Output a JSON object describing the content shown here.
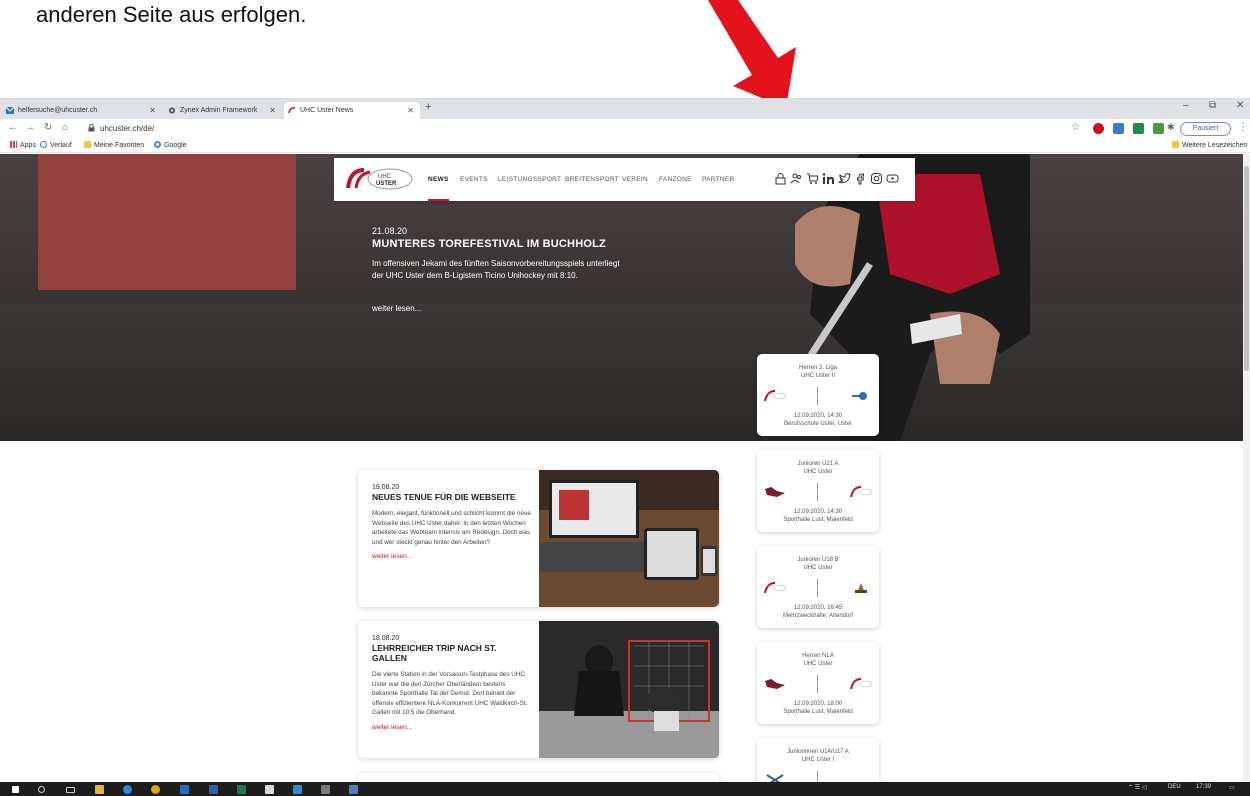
{
  "document": {
    "text": "anderen Seite aus erfolgen."
  },
  "browser": {
    "tabs": [
      {
        "label": "helfersuche@uhcuster.ch"
      },
      {
        "label": "Zynex Admin Framework"
      },
      {
        "label": "UHC Uster News"
      }
    ],
    "url": "uhcuster.ch/de/",
    "pause_label": "Pausiert",
    "bookmarks": [
      "Apps",
      "Verlauf",
      "Meine Favoriten",
      "Google"
    ],
    "bookmarks_right": "Weitere Lesezeichen"
  },
  "site": {
    "logo_alt": "UHC USTER",
    "nav": [
      "NEWS",
      "EVENTS",
      "LEISTUNGSSPORT",
      "BREITENSPORT",
      "VEREIN",
      "FANZONE",
      "PARTNER"
    ],
    "icons": [
      "lock-icon",
      "people-icon",
      "cart-icon",
      "linkedin-icon",
      "twitter-icon",
      "facebook-icon",
      "instagram-icon",
      "youtube-icon"
    ],
    "hero": {
      "date": "21.08.20",
      "title": "MUNTERES TOREFESTIVAL IM BUCHHOLZ",
      "body": "Im offensiven Jekami des fünften Saisonvorbereitungsspiels unterliegt der UHC Uster dem B-Ligistem Ticino Unihockey mit 8:10.",
      "more": "weiter lesen..."
    },
    "news": [
      {
        "date": "19.08.20",
        "title": "NEUES TENUE FÜR DIE WEBSEITE",
        "body": "Modern, elegant, funktionell und schlicht kommt die neue Webseite des UHC Uster daher. In den letzten Wochen arbeitete das Webteam intensiv am Redesign. Doch was und wer steckt genau hinter den Arbeiten?",
        "more": "weiter lesen..."
      },
      {
        "date": "18.08.20",
        "title": "LEHRREICHER TRIP NACH ST. GALLEN",
        "body": "Die vierte Station in der Vorsaison-Testphase des UHC Uster war die den Zürcher Oberländern bestens bekannte Sporthalle Tal der Demut. Dort behielt der offensiv effizientere NLA-Konkurrent UHC Waldkirch-St. Gallen mit 10:5 die Oberhand.",
        "more": "weiter lesen..."
      }
    ],
    "games": [
      {
        "league": "Herren 2. Liga",
        "team": "UHC Uster II",
        "datetime": "12.09.2020, 14:30",
        "venue": "Berufsschule Uster, Uster"
      },
      {
        "league": "Junioren U21 A",
        "team": "UHC Uster",
        "datetime": "12.09.2020, 14:30",
        "venue": "Sporthalle Lust, Maienfeld"
      },
      {
        "league": "Junioren U18 B",
        "team": "UHC Uster",
        "datetime": "12.09.2020, 16:45",
        "venue": "Mehrzweckhalle, Altendorf"
      },
      {
        "league": "Herren NLA",
        "team": "UHC Uster",
        "datetime": "12.09.2020, 18:00",
        "venue": "Sporthalle Lust, Maienfeld"
      },
      {
        "league": "Juniorinnen U14/U17 A",
        "team": "UHC Uster I",
        "datetime": "",
        "venue": ""
      }
    ]
  },
  "taskbar": {
    "lang": "DEU",
    "time": "17:39"
  },
  "colors": {
    "accent": "#c8102e",
    "arrow": "#e3121c"
  }
}
